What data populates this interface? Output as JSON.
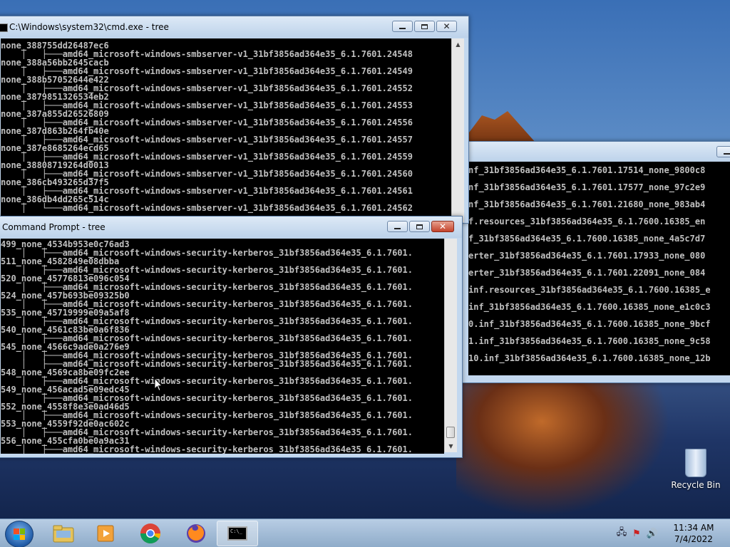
{
  "windows": {
    "back": {
      "title": "C:\\Windows\\system32\\cmd.exe - tree",
      "lines": [
        "none_388755dd26487ec6",
        "    │   ├───amd64_microsoft-windows-smbserver-v1_31bf3856ad364e35_6.1.7601.24548",
        "none_388a56bb2645cacb",
        "    │   ├───amd64_microsoft-windows-smbserver-v1_31bf3856ad364e35_6.1.7601.24549",
        "none_388b57052644e422",
        "    │   ├───amd64_microsoft-windows-smbserver-v1_31bf3856ad364e35_6.1.7601.24552",
        "none_3879851326534eb2",
        "    │   ├───amd64_microsoft-windows-smbserver-v1_31bf3856ad364e35_6.1.7601.24553",
        "none_387a855d26526809",
        "    │   ├───amd64_microsoft-windows-smbserver-v1_31bf3856ad364e35_6.1.7601.24556",
        "none_387d863b264fb40e",
        "    │   ├───amd64_microsoft-windows-smbserver-v1_31bf3856ad364e35_6.1.7601.24557",
        "none_387e8685264ecd65",
        "    │   ├───amd64_microsoft-windows-smbserver-v1_31bf3856ad364e35_6.1.7601.24559",
        "none_38808719264d0013",
        "    │   ├───amd64_microsoft-windows-smbserver-v1_31bf3856ad364e35_6.1.7601.24560",
        "none_386cb493265d37f5",
        "    │   ├───amd64_microsoft-windows-smbserver-v1_31bf3856ad364e35_6.1.7601.24561",
        "none_386db4dd265c514c",
        "    │   └───amd64_microsoft-windows-smbserver-v1_31bf3856ad364e35_6.1.7601.24562"
      ]
    },
    "right": {
      "lines": [
        "nf_31bf3856ad364e35_6.1.7601.17514_none_9800c8",
        "nf_31bf3856ad364e35_6.1.7601.17577_none_97c2e9",
        "nf_31bf3856ad364e35_6.1.7601.21680_none_983ab4",
        "f.resources_31bf3856ad364e35_6.1.7600.16385_en",
        "f_31bf3856ad364e35_6.1.7600.16385_none_4a5c7d7",
        "erter_31bf3856ad364e35_6.1.7601.17933_none_080",
        "erter_31bf3856ad364e35_6.1.7601.22091_none_084",
        "inf.resources_31bf3856ad364e35_6.1.7600.16385_e",
        "inf_31bf3856ad364e35_6.1.7600.16385_none_e1c0c3",
        "0.inf_31bf3856ad364e35_6.1.7600.16385_none_9bcf",
        "1.inf_31bf3856ad364e35_6.1.7600.16385_none_9c58",
        "10.inf_31bf3856ad364e35_6.1.7600.16385_none_12b"
      ]
    },
    "front": {
      "title": "Command Prompt - tree",
      "lines": [
        "499_none_4534b953e0c76ad3",
        "    │   ├───amd64_microsoft-windows-security-kerberos_31bf3856ad364e35_6.1.7601.",
        "511_none_4582849e08dbba",
        "    │   ├───amd64_microsoft-windows-security-kerberos_31bf3856ad364e35_6.1.7601.",
        "520_none_45776813e096c054",
        "    │   ├───amd64_microsoft-windows-security-kerberos_31bf3856ad364e35_6.1.7601.",
        "524_none_457b693be09325b0",
        "    │   ├───amd64_microsoft-windows-security-kerberos_31bf3856ad364e35_6.1.7601.",
        "535_none_45719999e09a5af8",
        "    │   ├───amd64_microsoft-windows-security-kerberos_31bf3856ad364e35_6.1.7601.",
        "540_none_4561c83be0a6f836",
        "    │   ├───amd64_microsoft-windows-security-kerberos_31bf3856ad364e35_6.1.7601.",
        "545_none_4566c9ade0a276e9",
        "    │   ├───amd64_microsoft-windows-security-kerberos_31bf3856ad364e35_6.1.7601.",
        "    │   ├───amd64_microsoft-windows-security-kerberos_31bf3856ad364e35_6.1.7601.",
        "548_none_4569ca8be09fc2ee",
        "    │   ├───amd64_microsoft-windows-security-kerberos_31bf3856ad364e35_6.1.7601.",
        "549_none_456acad5e09edc45",
        "    │   ├───amd64_microsoft-windows-security-kerberos_31bf3856ad364e35_6.1.7601.",
        "552_none_4558f8e3e0ad46d5",
        "    │   ├───amd64_microsoft-windows-security-kerberos_31bf3856ad364e35_6.1.7601.",
        "553_none_4559f92de0ac602c",
        "    │   ├───amd64_microsoft-windows-security-kerberos_31bf3856ad364e35_6.1.7601.",
        "556_none_455cfa0be0a9ac31",
        "    │   ├───amd64_microsoft-windows-security-kerberos_31bf3856ad364e35_6.1.7601."
      ]
    }
  },
  "desktop": {
    "recycle_bin_label": "Recycle Bin"
  },
  "taskbar": {
    "clock_time": "11:34 AM",
    "clock_date": "7/4/2022",
    "pinned": [
      "start-button",
      "explorer",
      "media-player",
      "chrome",
      "firefox",
      "cmd"
    ]
  },
  "colors": {
    "console_bg": "#000000",
    "console_fg": "#c0c0c0",
    "close_red": "#c4432b"
  }
}
